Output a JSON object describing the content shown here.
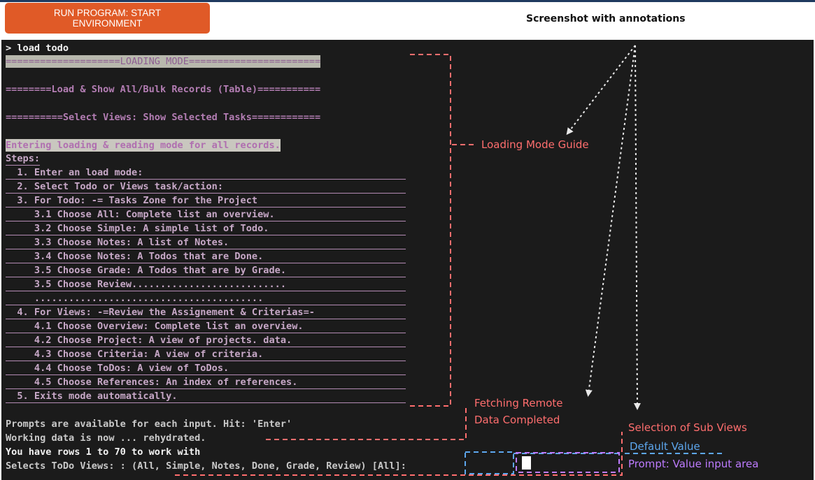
{
  "header": {
    "run_button_line1": "RUN PROGRAM: START",
    "run_button_line2": "ENVIRONMENT",
    "title": "Screenshot with annotations"
  },
  "terminal": {
    "command": "> load todo",
    "banner_loading": "====================LOADING MODE=======================",
    "banner_load_show": "========Load & Show All/Bulk Records (Table)===========",
    "banner_select_views": "==========Select Views: Show Selected Tasks============",
    "entering": "Entering loading & reading mode for all records.",
    "steps_label": "Steps:",
    "steps": [
      "  1. Enter an load mode:",
      "  2. Select Todo or Views task/action:",
      "  3. For Todo: -= Tasks Zone for the Project",
      "     3.1 Choose All: Complete list an overview.",
      "     3.2 Choose Simple: A simple list of Todo.",
      "     3.3 Choose Notes: A list of Notes.",
      "     3.4 Choose Notes: A Todos that are Done.",
      "     3.5 Choose Grade: A Todos that are by Grade.",
      "     3.5 Choose Review...........................",
      "     ........................................",
      "  4. For Views: -=Review the Assignement & Criterias=-",
      "     4.1 Choose Overview: Complete list an overview.",
      "     4.2 Choose Project: A view of projects. data.",
      "     4.3 Choose Criteria: A view of criteria.",
      "     4.4 Choose ToDos: A view of ToDos.",
      "     4.5 Choose References: An index of references.",
      "  5. Exits mode automatically."
    ],
    "prompts_line": "Prompts are available for each input. Hit: 'Enter'",
    "working_line": "Working data is now ... rehydrated.",
    "rows_line": "You have rows 1 to 70 to work with",
    "select_line": "Selects ToDo Views: : (All, Simple, Notes, Done, Grade, Review) [All]:"
  },
  "annotations": {
    "loading_mode_guide": "Loading Mode Guide",
    "fetching_line1": "Fetching Remote",
    "fetching_line2": "Data Completed",
    "selection_sub_views": "Selection of Sub Views",
    "default_value": "Default Value",
    "prompt_value": "Prompt: Value input area"
  },
  "colors": {
    "annotation_red": "#ff6e6e",
    "annotation_blue": "#5da7ee",
    "annotation_purple": "#bd7bff",
    "run_button": "#e05a27",
    "terminal_bg": "#1b1b1b"
  }
}
